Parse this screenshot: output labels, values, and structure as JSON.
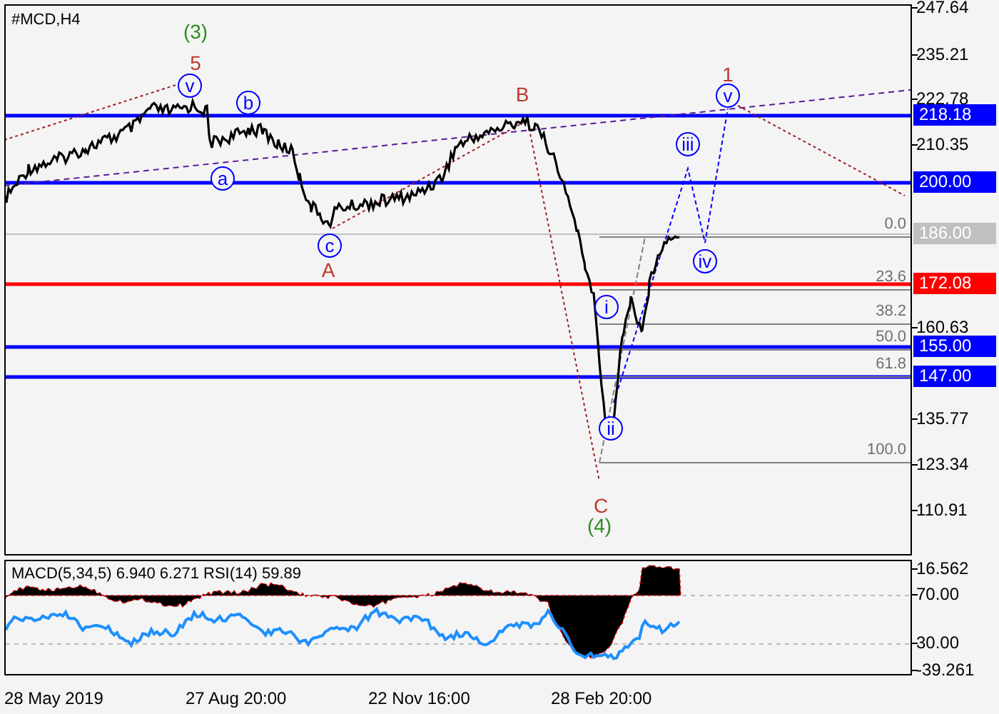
{
  "chart": {
    "symbol": "#MCD,H4",
    "price_ticks": [
      "247.64",
      "235.21",
      "222.78",
      "210.35",
      "160.63",
      "135.77",
      "123.34",
      "110.91"
    ],
    "levels": [
      {
        "label": "218.18",
        "color": "#0000ff"
      },
      {
        "label": "200.00",
        "color": "#0000ff"
      },
      {
        "label": "186.00",
        "color": "#c0c0c0"
      },
      {
        "label": "172.08",
        "color": "#ff0000"
      },
      {
        "label": "155.00",
        "color": "#0000ff"
      },
      {
        "label": "147.00",
        "color": "#0000ff"
      }
    ],
    "fibonacci": [
      "0.0",
      "23.6",
      "38.2",
      "50.0",
      "61.8",
      "100.0"
    ],
    "waves": [
      {
        "text": "(3)",
        "kind": "plain",
        "color": "#2e8b22"
      },
      {
        "text": "5",
        "kind": "plain",
        "color": "#c0392b"
      },
      {
        "text": "v",
        "kind": "circled",
        "color": "#0000ff"
      },
      {
        "text": "b",
        "kind": "circled",
        "color": "#0000ff"
      },
      {
        "text": "a",
        "kind": "circled",
        "color": "#0000ff"
      },
      {
        "text": "c",
        "kind": "circled",
        "color": "#0000ff"
      },
      {
        "text": "A",
        "kind": "plain",
        "color": "#c0392b"
      },
      {
        "text": "B",
        "kind": "plain",
        "color": "#c0392b"
      },
      {
        "text": "1",
        "kind": "plain",
        "color": "#c0392b"
      },
      {
        "text": "v",
        "kind": "circled",
        "color": "#0000ff"
      },
      {
        "text": "iii",
        "kind": "circled",
        "color": "#0000ff"
      },
      {
        "text": "iv",
        "kind": "circled",
        "color": "#0000ff"
      },
      {
        "text": "i",
        "kind": "circled",
        "color": "#0000ff"
      },
      {
        "text": "ii",
        "kind": "circled",
        "color": "#0000ff"
      },
      {
        "text": "C",
        "kind": "plain",
        "color": "#c0392b"
      },
      {
        "text": "(4)",
        "kind": "plain",
        "color": "#2e8b22"
      }
    ]
  },
  "indicator": {
    "title": "MACD(5,34,5) 6.940 6.271 RSI(14) 59.89",
    "axis": [
      "16.562",
      "70.00",
      "30.00",
      "-39.261"
    ]
  },
  "time_axis": [
    "28 May 2019",
    "27 Aug 20:00",
    "22 Nov 16:00",
    "28 Feb 20:00"
  ]
}
